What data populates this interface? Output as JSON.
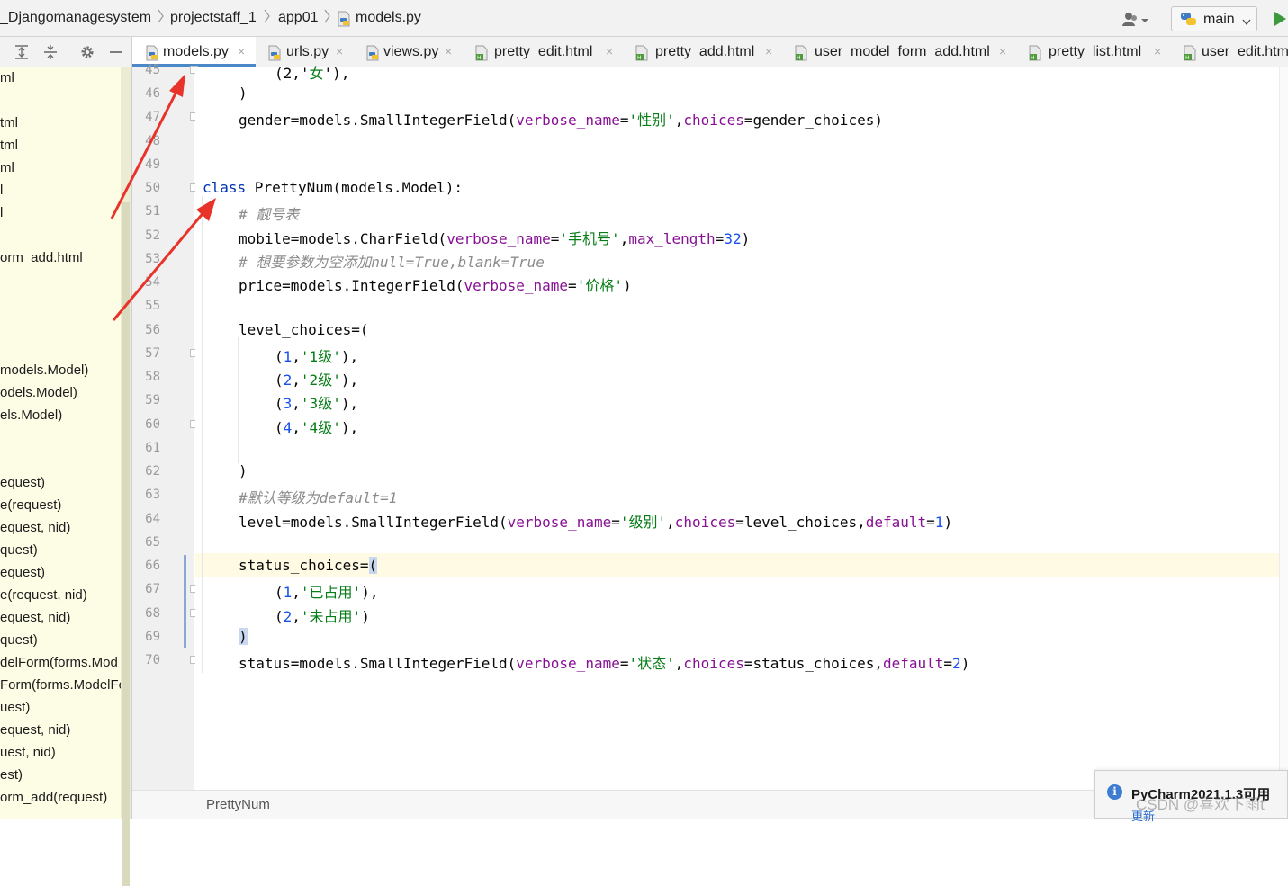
{
  "breadcrumbs": {
    "project": "_Djangomanagesystem",
    "folder1": "projectstaff_1",
    "folder2": "app01",
    "file": "models.py"
  },
  "vcs": {
    "branch": "main"
  },
  "tree_items": [
    "ml",
    "tml",
    "tml",
    "ml",
    "l",
    "l",
    "orm_add.html",
    "models.Model)",
    "odels.Model)",
    "els.Model)",
    "equest)",
    "e(request)",
    "equest, nid)",
    "quest)",
    "equest)",
    "e(request, nid)",
    "equest, nid)",
    "quest)",
    "delForm(forms.Mod",
    "Form(forms.ModelFo",
    "uest)",
    "equest, nid)",
    "uest, nid)",
    "est)",
    "orm_add(request)"
  ],
  "tabs": [
    {
      "label": "models.py",
      "icon": "python-file-icon"
    },
    {
      "label": "urls.py",
      "icon": "python-file-icon"
    },
    {
      "label": "views.py",
      "icon": "python-file-icon"
    },
    {
      "label": "pretty_edit.html",
      "icon": "html-file-icon"
    },
    {
      "label": "pretty_add.html",
      "icon": "html-file-icon"
    },
    {
      "label": "user_model_form_add.html",
      "icon": "html-file-icon"
    },
    {
      "label": "pretty_list.html",
      "icon": "html-file-icon"
    },
    {
      "label": "user_edit.htm",
      "icon": "html-file-icon"
    }
  ],
  "tab_close": "×",
  "line_numbers": [
    "45",
    "46",
    "47",
    "48",
    "49",
    "50",
    "51",
    "52",
    "53",
    "54",
    "55",
    "56",
    "57",
    "58",
    "59",
    "60",
    "61",
    "62",
    "63",
    "64",
    "65",
    "66",
    "67",
    "68",
    "69",
    "70"
  ],
  "code": {
    "l45_a": "(2,'",
    "l45_b": "女",
    "l45_c": "'),",
    "l46": ")",
    "l47_a": "gender=models.SmallIntegerField(",
    "l47_b": "verbose_name",
    "l47_c": "=",
    "l47_d": "'性别'",
    "l47_e": ",",
    "l47_f": "choices",
    "l47_g": "=gender_choices)",
    "l50_a": "class",
    "l50_b": " PrettyNum(models.Model):",
    "l51": "# 靓号表",
    "l52_a": "mobile=models.CharField(",
    "l52_b": "verbose_name",
    "l52_c": "=",
    "l52_d": "'手机号'",
    "l52_e": ",",
    "l52_f": "max_length",
    "l52_g": "=",
    "l52_h": "32",
    "l52_i": ")",
    "l53": "# 想要参数为空添加null=True,blank=True",
    "l54_a": "price=models.IntegerField(",
    "l54_b": "verbose_name",
    "l54_c": "=",
    "l54_d": "'价格'",
    "l54_e": ")",
    "l56": "level_choices=(",
    "l57_a": "(",
    "l57_b": "1",
    "l57_c": ",",
    "l57_d": "'1级'",
    "l57_e": "),",
    "l58_a": "(",
    "l58_b": "2",
    "l58_c": ",",
    "l58_d": "'2级'",
    "l58_e": "),",
    "l59_a": "(",
    "l59_b": "3",
    "l59_c": ",",
    "l59_d": "'3级'",
    "l59_e": "),",
    "l60_a": "(",
    "l60_b": "4",
    "l60_c": ",",
    "l60_d": "'4级'",
    "l60_e": "),",
    "l62": ")",
    "l63": "#默认等级为default=1",
    "l64_a": "level=models.SmallIntegerField(",
    "l64_b": "verbose_name",
    "l64_c": "=",
    "l64_d": "'级别'",
    "l64_e": ",",
    "l64_f": "choices",
    "l64_g": "=level_choices,",
    "l64_h": "default",
    "l64_i": "=",
    "l64_j": "1",
    "l64_k": ")",
    "l66_a": "status_choices=",
    "l66_b": "(",
    "l67_a": "(",
    "l67_b": "1",
    "l67_c": ",",
    "l67_d": "'已占用'",
    "l67_e": "),",
    "l68_a": "(",
    "l68_b": "2",
    "l68_c": ",",
    "l68_d": "'未占用'",
    "l68_e": ")",
    "l69": ")",
    "l70_a": "status=models.SmallIntegerField(",
    "l70_b": "verbose_name",
    "l70_c": "=",
    "l70_d": "'状态'",
    "l70_e": ",",
    "l70_f": "choices",
    "l70_g": "=status_choices,",
    "l70_h": "default",
    "l70_i": "=",
    "l70_j": "2",
    "l70_k": ")"
  },
  "status": {
    "breadcrumb": "PrettyNum"
  },
  "notification": {
    "title": "PyCharm2021.1.3可用",
    "link": "更新",
    "icon": "i"
  },
  "watermark": "CSDN @喜欢下雨t",
  "colors": {
    "accent": "#4a88c7",
    "keyword": "#0033b3",
    "param": "#871094",
    "string": "#067d17",
    "number": "#1750eb",
    "comment": "#8c8c8c",
    "arrow": "#e8332a"
  }
}
